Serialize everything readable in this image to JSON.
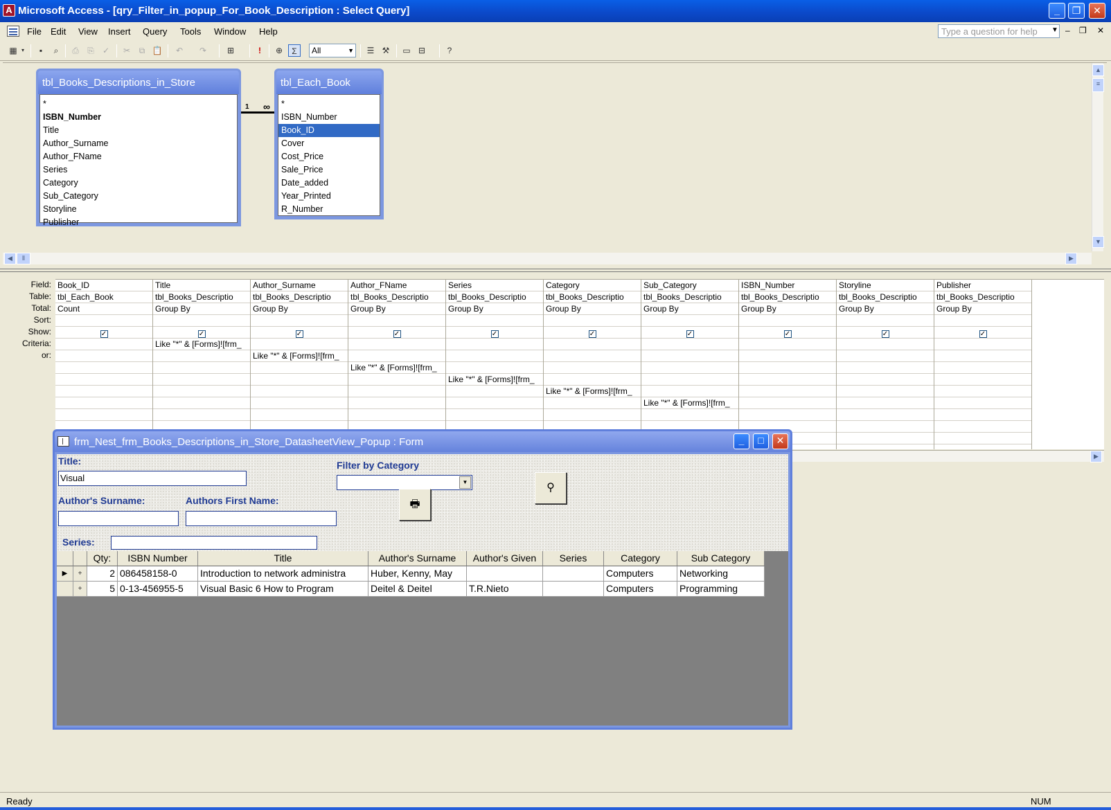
{
  "window": {
    "title": "Microsoft Access - [qry_Filter_in_popup_For_Book_Description : Select Query]"
  },
  "menu": [
    "File",
    "Edit",
    "View",
    "Insert",
    "Query",
    "Tools",
    "Window",
    "Help"
  ],
  "help_placeholder": "Type a question for help",
  "toolbar": {
    "query_type_value": "All"
  },
  "tables": [
    {
      "name": "tbl_Books_Descriptions_in_Store",
      "fields": [
        "*",
        "ISBN_Number",
        "Title",
        "Author_Surname",
        "Author_FName",
        "Series",
        "Category",
        "Sub_Category",
        "Storyline",
        "Publisher"
      ],
      "primary_key": "ISBN_Number"
    },
    {
      "name": "tbl_Each_Book",
      "fields": [
        "*",
        "ISBN_Number",
        "Book_ID",
        "Cover",
        "Cost_Price",
        "Sale_Price",
        "Date_added",
        "Year_Printed",
        "R_Number"
      ],
      "selected": "Book_ID"
    }
  ],
  "join": {
    "one": "1",
    "many": "∞"
  },
  "grid": {
    "row_labels": [
      "Field:",
      "Table:",
      "Total:",
      "Sort:",
      "Show:",
      "Criteria:",
      "or:"
    ],
    "columns": [
      {
        "field": "Book_ID",
        "table": "tbl_Each_Book",
        "total": "Count",
        "criteria_row": -1,
        "criteria": ""
      },
      {
        "field": "Title",
        "table": "tbl_Books_Descriptio",
        "total": "Group By",
        "criteria_row": 0,
        "criteria": "Like \"*\" & [Forms]![frm_"
      },
      {
        "field": "Author_Surname",
        "table": "tbl_Books_Descriptio",
        "total": "Group By",
        "criteria_row": 1,
        "criteria": "Like \"*\" & [Forms]![frm_"
      },
      {
        "field": "Author_FName",
        "table": "tbl_Books_Descriptio",
        "total": "Group By",
        "criteria_row": 2,
        "criteria": "Like \"*\" & [Forms]![frm_"
      },
      {
        "field": "Series",
        "table": "tbl_Books_Descriptio",
        "total": "Group By",
        "criteria_row": 3,
        "criteria": "Like \"*\" & [Forms]![frm_"
      },
      {
        "field": "Category",
        "table": "tbl_Books_Descriptio",
        "total": "Group By",
        "criteria_row": 4,
        "criteria": "Like \"*\" & [Forms]![frm_"
      },
      {
        "field": "Sub_Category",
        "table": "tbl_Books_Descriptio",
        "total": "Group By",
        "criteria_row": 5,
        "criteria": "Like \"*\" & [Forms]![frm_"
      },
      {
        "field": "ISBN_Number",
        "table": "tbl_Books_Descriptio",
        "total": "Group By",
        "criteria_row": -1,
        "criteria": ""
      },
      {
        "field": "Storyline",
        "table": "tbl_Books_Descriptio",
        "total": "Group By",
        "criteria_row": -1,
        "criteria": ""
      },
      {
        "field": "Publisher",
        "table": "tbl_Books_Descriptio",
        "total": "Group By",
        "criteria_row": -1,
        "criteria": ""
      }
    ]
  },
  "popup": {
    "title": "frm_Nest_frm_Books_Descriptions_in_Store_DatasheetView_Popup : Form",
    "title_label": "Title:",
    "title_value": "Visual",
    "filter_category_label": "Filter by Category",
    "filter_category_value": "",
    "surname_label": "Author's Surname:",
    "surname_value": "",
    "firstname_label": "Authors First Name:",
    "firstname_value": "",
    "series_label": "Series:",
    "series_value": "",
    "datasheet": {
      "headers": [
        "Qty:",
        "ISBN Number",
        "Title",
        "Author's Surname",
        "Author's Given",
        "Series",
        "Category",
        "Sub Category"
      ],
      "rows": [
        {
          "qty": "2",
          "isbn": "086458158-0",
          "title": "Introduction to network administra",
          "surname": "Huber, Kenny, May",
          "given": "",
          "series": "",
          "category": "Computers",
          "sub_category": "Networking"
        },
        {
          "qty": "5",
          "isbn": "0-13-456955-5",
          "title": "Visual Basic 6 How to Program",
          "surname": "Deitel & Deitel",
          "given": "T.R.Nieto",
          "series": "",
          "category": "Computers",
          "sub_category": "Programming"
        }
      ]
    }
  },
  "status": {
    "text": "Ready",
    "num": "NUM"
  }
}
